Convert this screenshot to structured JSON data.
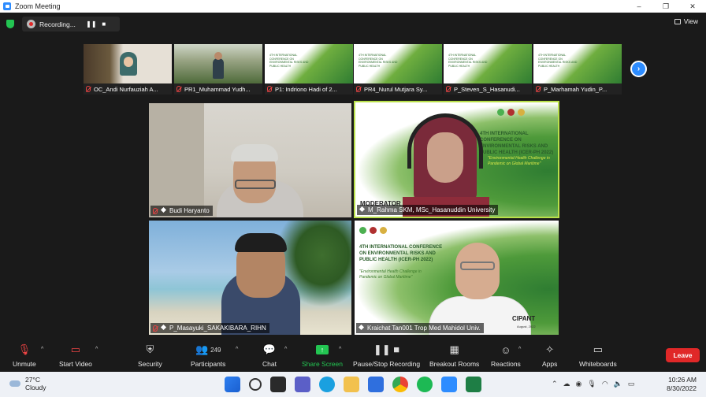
{
  "window": {
    "title": "Zoom Meeting",
    "controls": [
      "–",
      "❐",
      "✕"
    ]
  },
  "top": {
    "recording_label": "Recording...",
    "view_label": "View"
  },
  "thumbnails": [
    {
      "name": "OC_Andi Nurfauziah A..."
    },
    {
      "name": "PR1_Muhammad Yudh..."
    },
    {
      "name": "P1: Indriono Hadi of 2..."
    },
    {
      "name": "PR4_Nurul Mutjara Sy..."
    },
    {
      "name": "P_Steven_S_Hasanudi..."
    },
    {
      "name": "P_Marhamah Yudin_P..."
    }
  ],
  "slide": {
    "conference": "4TH INTERNATIONAL CONFERENCE ON ENVIRONMENTAL RISKS AND PUBLIC HEALTH (ICER-PH 2022)",
    "theme": "\"Environmental Health Challenge in Pandemic on Global Maritime\""
  },
  "tiles": {
    "t1": {
      "name": "Budi Haryanto"
    },
    "t2": {
      "name": "M_Rahma SKM, MSc_Hasanuddin University",
      "role": "MODERATOR"
    },
    "t3": {
      "name": "P_Masayuki_SAKAKIBARA_RIHN"
    },
    "t4": {
      "name": "Kraichat Tan001 Trop Med Mahidol Univ.",
      "role": "CIPANT",
      "date": "August, 2022"
    }
  },
  "toolbar": {
    "unmute": "Unmute",
    "start_video": "Start Video",
    "security": "Security",
    "participants": "Participants",
    "participants_count": "249",
    "chat": "Chat",
    "share_screen": "Share Screen",
    "pause_recording": "Pause/Stop Recording",
    "breakout_rooms": "Breakout Rooms",
    "reactions": "Reactions",
    "apps": "Apps",
    "whiteboards": "Whiteboards",
    "leave": "Leave"
  },
  "taskbar": {
    "temperature": "27°C",
    "weather": "Cloudy",
    "time": "10:26 AM",
    "date": "8/30/2022"
  },
  "colors": {
    "accent": "#2d8cff",
    "leave": "#e02828",
    "share": "#23c552",
    "moderator_border": "#b9e04a"
  }
}
